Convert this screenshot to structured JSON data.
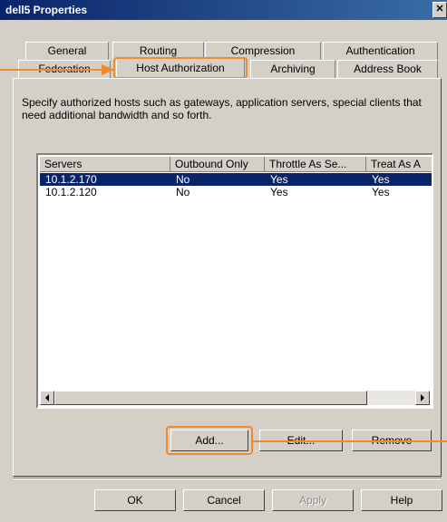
{
  "window": {
    "title": "dell5 Properties",
    "close_symbol": "✕"
  },
  "tabs_row1": [
    "General",
    "Routing",
    "Compression",
    "Authentication"
  ],
  "tabs_row2": [
    "Federation",
    "Host Authorization",
    "Archiving",
    "Address Book"
  ],
  "active_tab": "Host Authorization",
  "description": "Specify authorized hosts such as gateways, application servers, special clients that need additional bandwidth and so forth.",
  "list": {
    "columns": [
      "Servers",
      "Outbound Only",
      "Throttle As Se...",
      "Treat As A"
    ],
    "rows": [
      {
        "server": "10.1.2.170",
        "outbound": "No",
        "throttle": "Yes",
        "treat": "Yes",
        "selected": true
      },
      {
        "server": "10.1.2.120",
        "outbound": "No",
        "throttle": "Yes",
        "treat": "Yes",
        "selected": false
      }
    ]
  },
  "list_buttons": {
    "add": "Add...",
    "edit": "Edit...",
    "remove": "Remove"
  },
  "dialog_buttons": {
    "ok": "OK",
    "cancel": "Cancel",
    "apply": "Apply",
    "help": "Help"
  },
  "colors": {
    "highlight": "#f08a2c",
    "selection": "#0a246a",
    "titlebar": "#0a246a"
  }
}
